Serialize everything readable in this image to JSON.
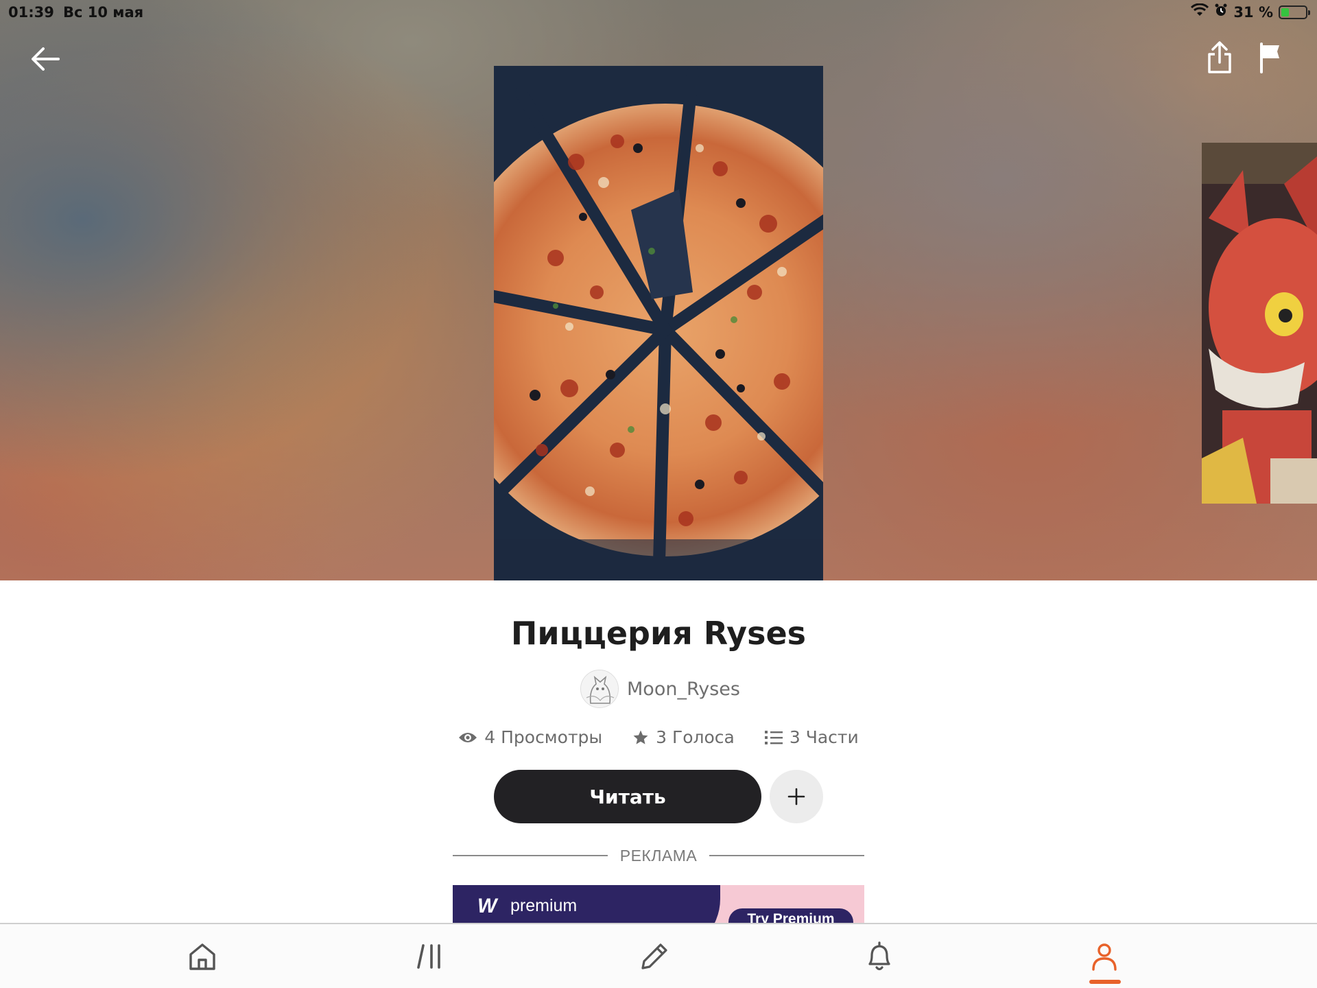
{
  "status_bar": {
    "time": "01:39",
    "date": "Вс 10 мая",
    "battery": "31 %",
    "battery_level": 0.31
  },
  "header": {
    "back_icon": "arrow-left-icon",
    "share_icon": "share-icon",
    "report_icon": "flag-icon"
  },
  "story": {
    "title": "Пиццерия Ryses",
    "author": "Moon_Ryses",
    "stats": {
      "views": "4 Просмотры",
      "votes": "3 Голоса",
      "parts": "3 Части"
    },
    "read_label": "Читать",
    "add_label": "+"
  },
  "ad": {
    "divider_label": "РЕКЛАМА",
    "logo": "W",
    "brand": "premium",
    "cta": "Try Premium"
  },
  "tabbar": {
    "items": [
      {
        "id": "home",
        "icon": "home-icon"
      },
      {
        "id": "library",
        "icon": "library-icon"
      },
      {
        "id": "write",
        "icon": "pencil-icon"
      },
      {
        "id": "notifications",
        "icon": "bell-icon"
      },
      {
        "id": "profile",
        "icon": "user-icon",
        "active": true
      }
    ]
  },
  "colors": {
    "accent": "#e8622a",
    "read_button": "#222124",
    "ad_dark": "#2d2463",
    "ad_pink": "#f6c9d4"
  }
}
